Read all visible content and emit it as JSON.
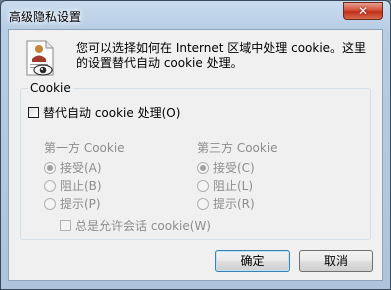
{
  "window": {
    "title": "高级隐私设置",
    "close_label": "✕"
  },
  "description": "您可以选择如何在 Internet 区域中处理 cookie。这里的设置替代自动 cookie 处理。",
  "cookie_group": {
    "title": "Cookie",
    "override_label": "替代自动 cookie 处理(O)",
    "override_checked": false,
    "first_party": {
      "header": "第一方 Cookie",
      "options": [
        "接受(A)",
        "阻止(B)",
        "提示(P)"
      ],
      "selected": 0
    },
    "third_party": {
      "header": "第三方 Cookie",
      "options": [
        "接受(C)",
        "阻止(L)",
        "提示(R)"
      ],
      "selected": 0
    },
    "session_label": "总是允许会话 cookie(W)",
    "session_checked": false
  },
  "buttons": {
    "ok": "确定",
    "cancel": "取消"
  }
}
